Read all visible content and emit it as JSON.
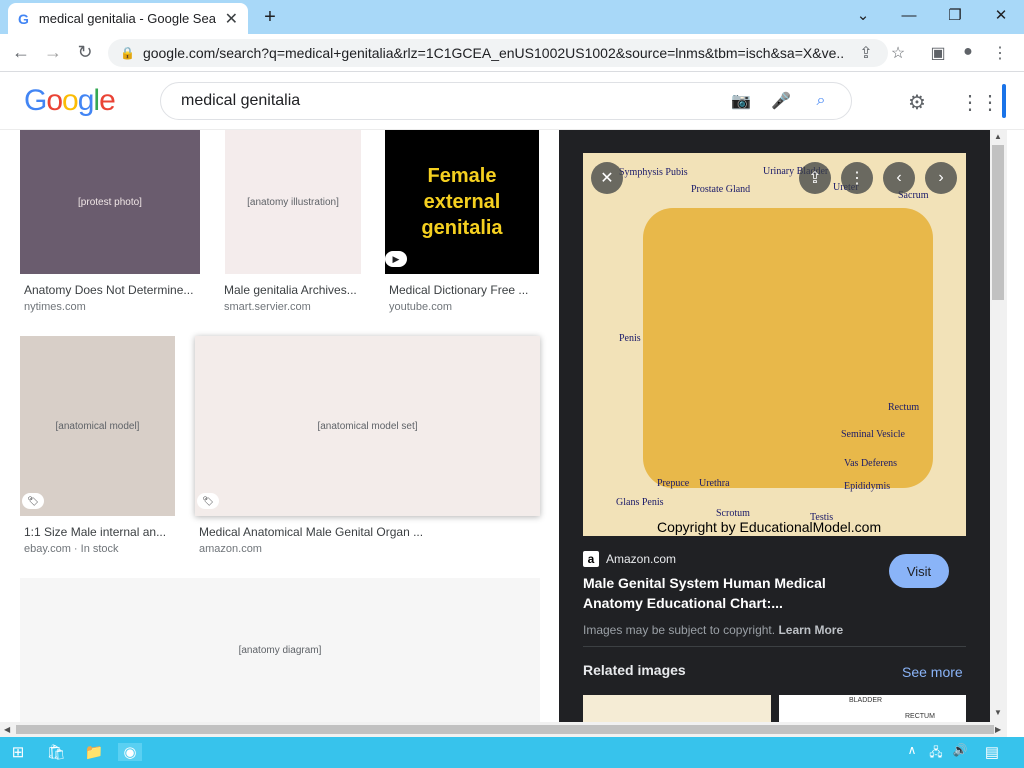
{
  "browser": {
    "tab_title": "medical genitalia - Google Sea",
    "favicon": "G",
    "url": "google.com/search?q=medical+genitalia&rlz=1C1GCEA_enUS1002US1002&source=lnms&tbm=isch&sa=X&ve..."
  },
  "google": {
    "logo": [
      "G",
      "o",
      "o",
      "g",
      "l",
      "e"
    ],
    "query": "medical genitalia"
  },
  "results": [
    {
      "title": "Anatomy Does Not Determine...",
      "source": "nytimes.com",
      "thumb_label": "[protest photo]"
    },
    {
      "title": "Male genitalia Archives...",
      "source": "smart.servier.com",
      "thumb_label": "[anatomy illustration]"
    },
    {
      "title": "Medical Dictionary Free ...",
      "source": "youtube.com",
      "thumb_label": "Female external genitalia"
    },
    {
      "title": "1:1 Size Male internal an...",
      "source": "ebay.com · In stock",
      "thumb_label": "[anatomical model]"
    },
    {
      "title": "Medical Anatomical Male Genital Organ ...",
      "source": "amazon.com",
      "thumb_label": "[anatomical model set]"
    },
    {
      "title": "",
      "source": "",
      "thumb_label": "[anatomy diagram]"
    }
  ],
  "preview": {
    "image_labels": {
      "symphysis": "Symphysis Pubis",
      "urinary": "Urinary Bladder",
      "ureter": "Ureter",
      "sacrum": "Sacrum",
      "prostate": "Prostate Gland",
      "penis": "Penis",
      "rectum": "Rectum",
      "seminal": "Seminal Vesicle",
      "vas": "Vas Deferens",
      "epididymis": "Epididymis",
      "prepuce": "Prepuce",
      "urethra": "Urethra",
      "glans": "Glans Penis",
      "scrotum": "Scrotum",
      "testis": "Testis",
      "copyright": "Copyright by EducationalModel.com"
    },
    "source": "Amazon.com",
    "title": "Male Genital System Human Medical Anatomy Educational Chart:...",
    "visit": "Visit",
    "copyright_note": "Images may be subject to copyright.",
    "learn_more": "Learn More",
    "related": "Related images",
    "see_more": "See more",
    "related_thumb_labels": [
      "",
      "BLADDER",
      "RECTUM"
    ]
  },
  "colors": {
    "titlebar": "#a8d8f8",
    "panel": "#202124",
    "visit_button": "#8ab4f8",
    "taskbar": "#37c3ec"
  }
}
